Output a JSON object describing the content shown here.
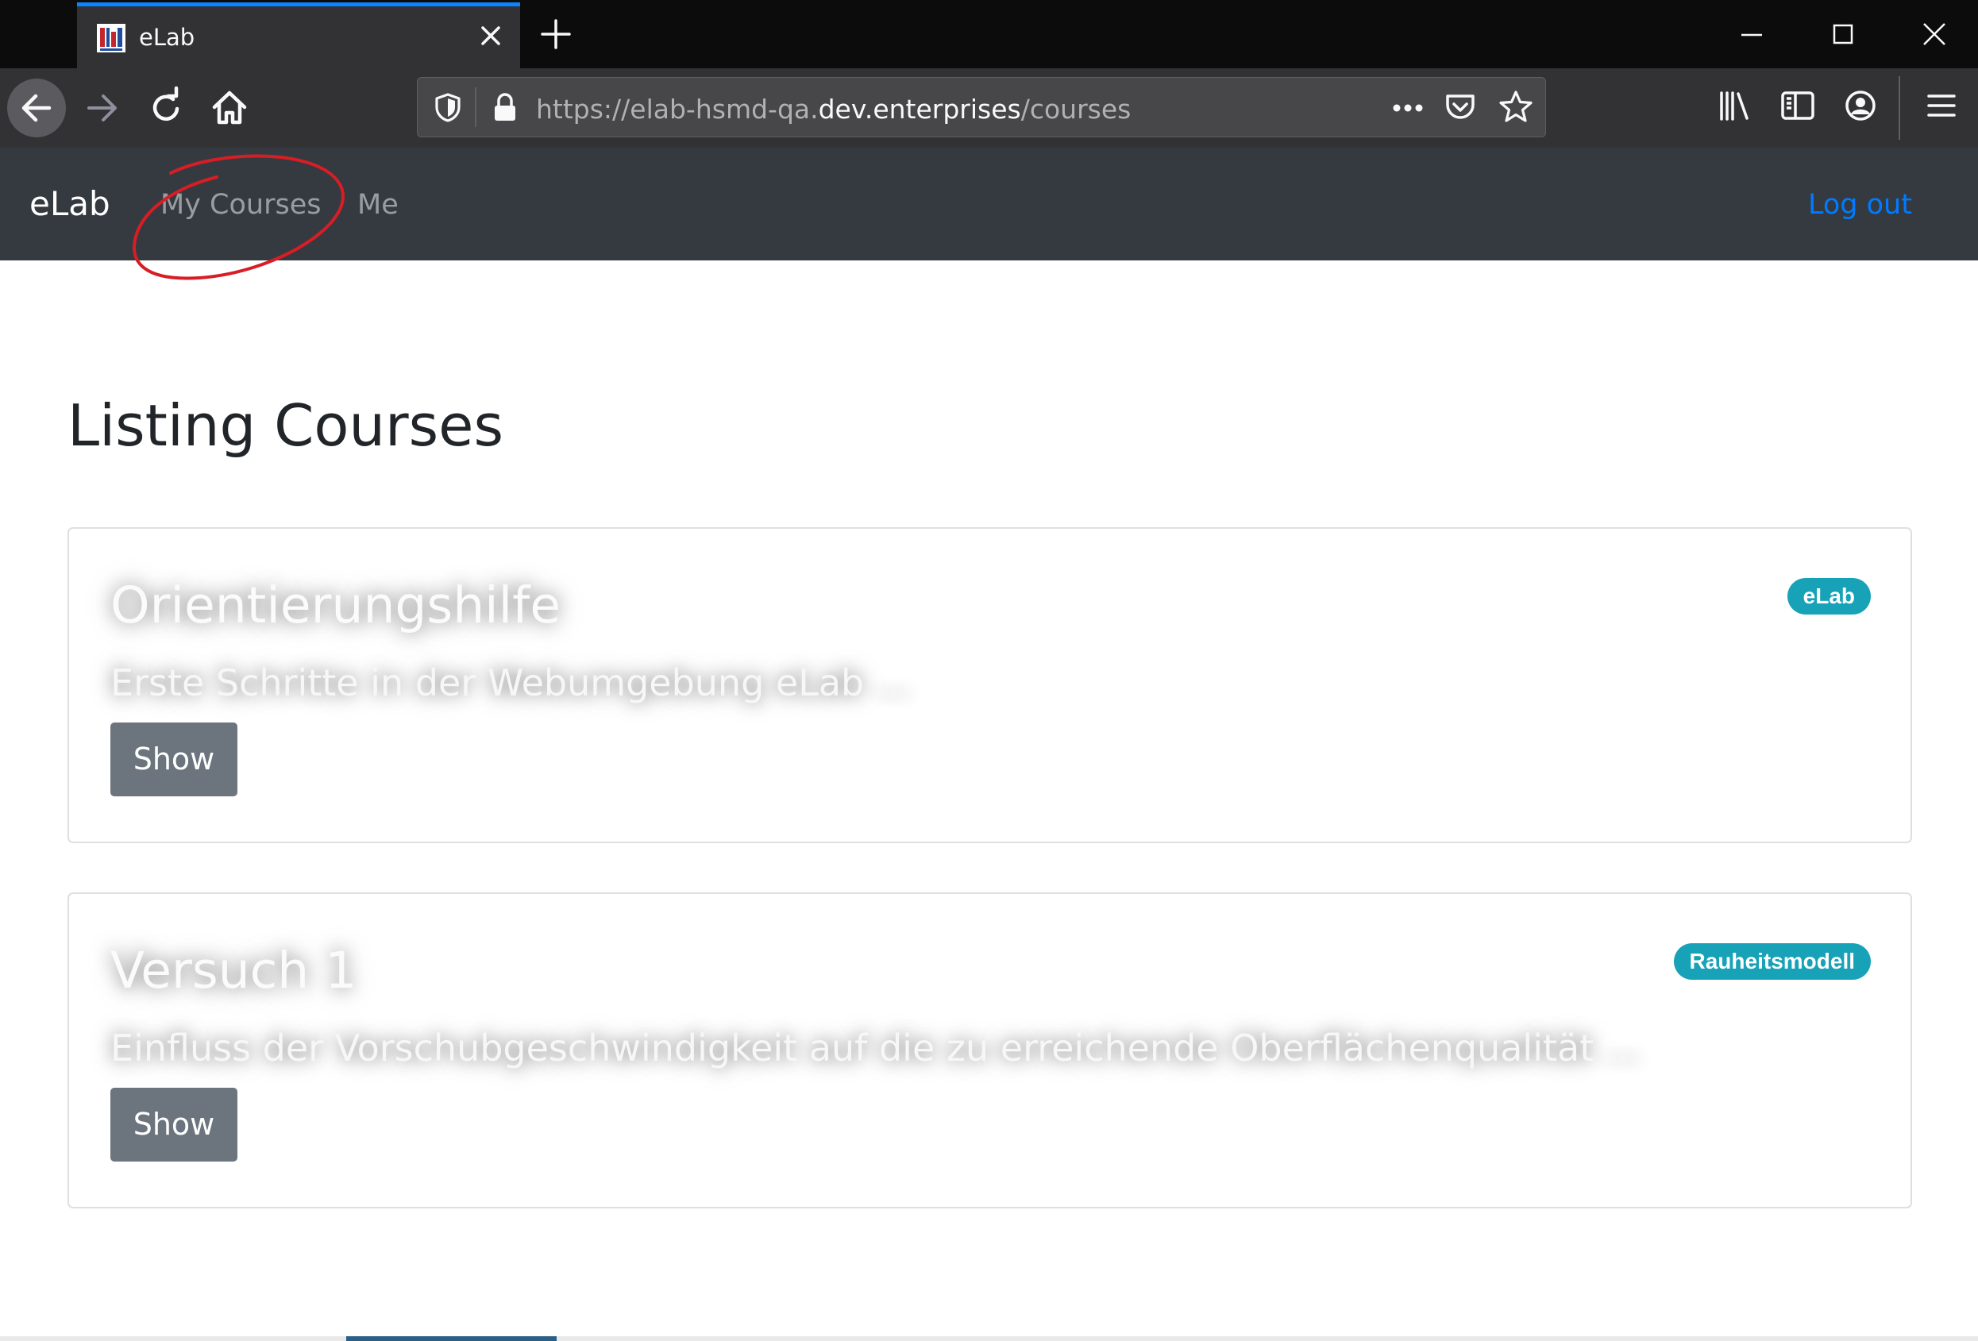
{
  "browser": {
    "tab_title": "eLab",
    "url": {
      "prefix": "https://elab-hsmd-qa.",
      "domain": "dev.enterprises",
      "path": "/courses"
    },
    "accent_color": "#0a84ff"
  },
  "navbar": {
    "brand": "eLab",
    "links": [
      "My Courses",
      "Me"
    ],
    "logout": "Log out"
  },
  "main": {
    "title": "Listing Courses",
    "courses": [
      {
        "title": "Orientierungshilfe",
        "description": "Erste Schritte in der Webumgebung eLab ...",
        "button": "Show",
        "badge": "eLab"
      },
      {
        "title": "Versuch 1",
        "description": "Einfluss der Vorschubgeschwindigkeit auf die zu erreichende Oberflächenqualität ...",
        "button": "Show",
        "badge": "Rauheitsmodell"
      }
    ]
  },
  "colors": {
    "navbar_bg": "#343a40",
    "badge": "#17a2b8",
    "button": "#6c757d",
    "link": "#007bff",
    "annotation": "#d81d25"
  }
}
